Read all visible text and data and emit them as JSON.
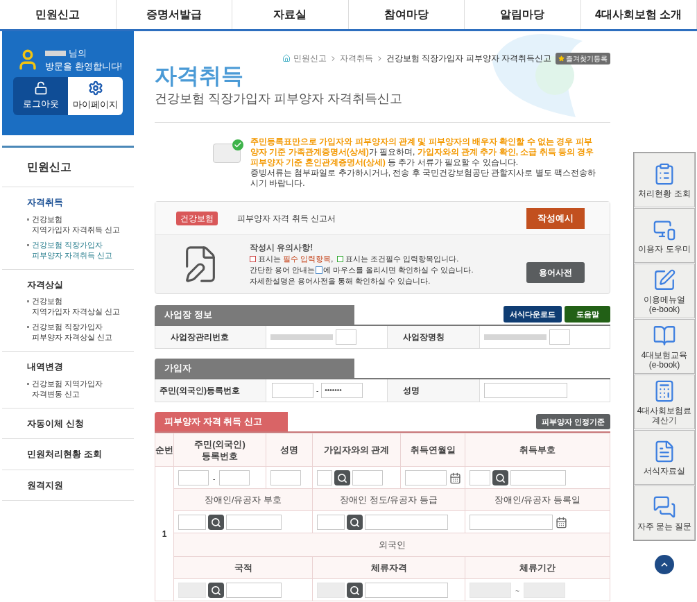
{
  "top_nav": [
    {
      "label": "민원신고",
      "selected": false
    },
    {
      "label": "증명서발급",
      "selected": false
    },
    {
      "label": "자료실",
      "selected": false
    },
    {
      "label": "참여마당",
      "selected": false
    },
    {
      "label": "알림마당",
      "selected": false
    },
    {
      "label": "4대사회보험 소개",
      "selected": false
    }
  ],
  "user_panel": {
    "greeting_suffix": "님의",
    "welcome": "방문을 환영합니다!",
    "buttons": [
      {
        "kind": "logout",
        "label": "로그아웃"
      },
      {
        "kind": "mypage",
        "label": "마이페이지"
      }
    ]
  },
  "side_menu": {
    "title": "민원신고",
    "sections": [
      {
        "label": "자격취득",
        "selected": true,
        "children": [
          {
            "label": "건강보험\n지역가입자 자격취득 신고",
            "selected": false
          },
          {
            "label": "건강보험 직장가입자\n피부양자 자격취득 신고",
            "selected": true
          }
        ]
      },
      {
        "label": "자격상실",
        "selected": false,
        "children": [
          {
            "label": "건강보험\n지역가입자 자격상실 신고",
            "selected": false
          },
          {
            "label": "건강보험 직장가입자\n피부양자 자격상실 신고",
            "selected": false
          }
        ]
      },
      {
        "label": "내역변경",
        "selected": false,
        "children": [
          {
            "label": "건강보험 지역가입자\n자격변동 신고",
            "selected": false
          }
        ]
      },
      {
        "label": "자동이체 신청",
        "selected": false
      },
      {
        "label": "민원처리현황 조회",
        "selected": false
      },
      {
        "label": "원격지원",
        "selected": false
      }
    ]
  },
  "breadcrumb": [
    "민원신고",
    "자격취득",
    "건강보험 직장가입자 피부양자 자격취득신고"
  ],
  "bookmark_button": "즐겨찾기등록",
  "page_title": "자격취득",
  "page_subtitle": "건강보험 직장가입자 피부양자 자격취득신고",
  "notice": [
    "**주민등록표만으로 가입자와 피부양자의 관계 및 피부양자의 배우자 확인할 수 없는 경우 피부양자 기준 가족관계증명서(상세)**가 필요하며, **가입자와의 관계 추가 확인, 소급 취득 등의 경우 피부양자 기준 혼인관계증명서(상세)** 등 추가 서류가 필요할 수 있습니다.",
    "증빙서류는 첨부파일로 추가하시거나, 전송 후 국민건강보험공단 관할지사로 별도 팩스전송하시기 바랍니다."
  ],
  "form_box": {
    "tag": "건강보험",
    "form_name": "피부양자 자격 취득 신고서",
    "example_button": "작성예시",
    "tips_title": "작성시 유의사항!",
    "required_text": "표시는 **필수 입력항목**,",
    "conditional_text": "표시는 조건필수 입력항목입니다.",
    "help_before": "간단한 용어 안내는",
    "help_after": "에 마우스를 올리시면 확인하실 수 있습니다.",
    "detail_text": "자세한설명은 용어사전을 통해 확인하실 수 있습니다.",
    "dictionary_button": "용어사전"
  },
  "workplace": {
    "title": "사업장 정보",
    "buttons": [
      {
        "kind": "download",
        "label": "서식다운로드"
      },
      {
        "kind": "help",
        "label": "도움말"
      }
    ],
    "fields": [
      {
        "label": "사업장관리번호"
      },
      {
        "label": "사업장명칭"
      }
    ]
  },
  "subscriber": {
    "title": "가입자",
    "id_label": "주민(외국인)등록번호",
    "id_separator": "-",
    "id_back": "•••••••",
    "name_label": "성명"
  },
  "dependents": {
    "title": "피부양자 자격 취득 신고",
    "criteria_button": "피부양자 인정기준",
    "columns": [
      "순번",
      "주민(외국인)\n등록번호",
      "성명",
      "가입자와의 관계",
      "취득연월일",
      "취득부호"
    ],
    "row_number": "1",
    "id_separator": "-",
    "disability_columns": [
      "장애인/유공자 부호",
      "장애인 정도/유공자 등급",
      "장애인/유공자 등록일"
    ],
    "foreign_title": "외국인",
    "foreign_columns": [
      "국적",
      "체류자격",
      "체류기간"
    ],
    "foreign_code_disabled": true,
    "period_separator": "~"
  },
  "quick_menu": [
    {
      "kind": "status",
      "label": "처리현황 조회"
    },
    {
      "kind": "helper",
      "label": "이용자 도우미"
    },
    {
      "kind": "manual",
      "label": "이용메뉴얼\n(e-book)"
    },
    {
      "kind": "education",
      "label": "4대보험교육\n(e-book)"
    },
    {
      "kind": "calculator",
      "label": "4대사회보험료\n계산기"
    },
    {
      "kind": "forms",
      "label": "서식자료실"
    },
    {
      "kind": "faq",
      "label": "자주 묻는 질문"
    }
  ]
}
